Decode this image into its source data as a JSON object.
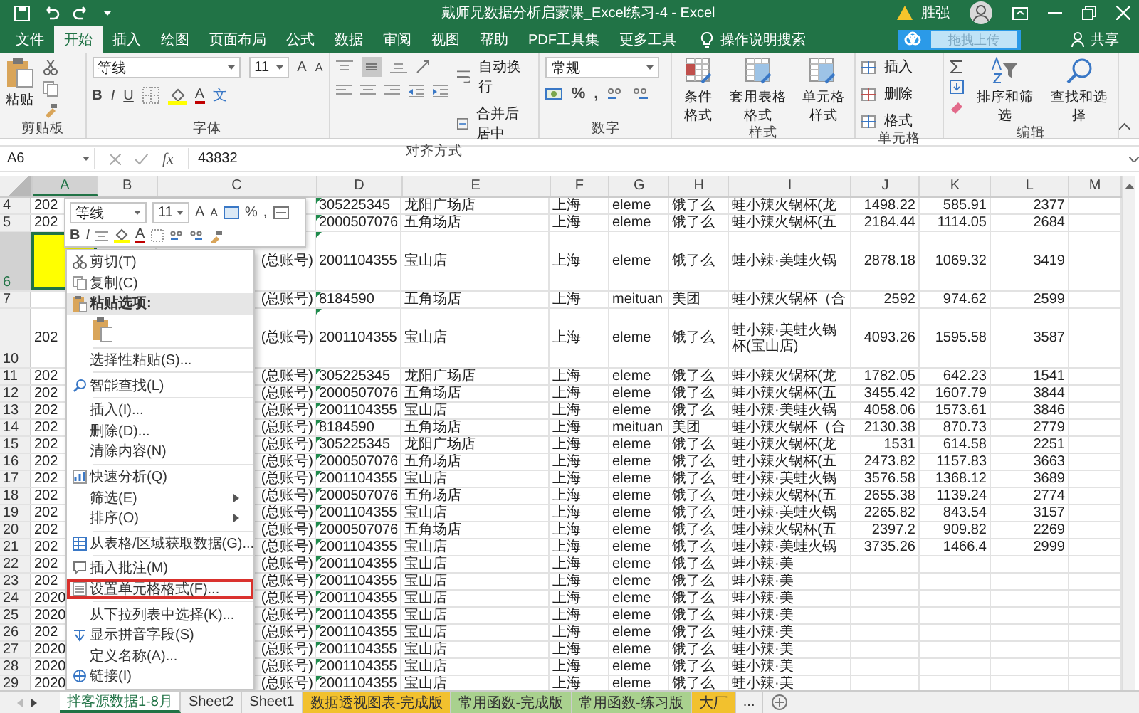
{
  "window": {
    "title": "戴师兄数据分析启蒙课_Excel练习-4  -  Excel",
    "user": "胜强"
  },
  "menu_tabs": [
    {
      "label": "文件",
      "selected": false
    },
    {
      "label": "开始",
      "selected": true
    },
    {
      "label": "插入",
      "selected": false
    },
    {
      "label": "绘图",
      "selected": false
    },
    {
      "label": "页面布局",
      "selected": false
    },
    {
      "label": "公式",
      "selected": false
    },
    {
      "label": "数据",
      "selected": false
    },
    {
      "label": "审阅",
      "selected": false
    },
    {
      "label": "视图",
      "selected": false
    },
    {
      "label": "帮助",
      "selected": false
    },
    {
      "label": "PDF工具集",
      "selected": false
    },
    {
      "label": "更多工具",
      "selected": false
    }
  ],
  "tell_me": "操作说明搜索",
  "upload_button": "拖拽上传",
  "share": "共享",
  "ribbon": {
    "clipboard": {
      "label": "剪贴板",
      "paste": "粘贴"
    },
    "font": {
      "label": "字体",
      "font_name": "等线",
      "font_size": "11",
      "grow": "A",
      "shrink": "A",
      "styles": [
        "B",
        "I",
        "U"
      ],
      "font_color": "A",
      "phonetic": "文"
    },
    "alignment": {
      "label": "对齐方式",
      "wrap": "自动换行",
      "merge": "合并后居中"
    },
    "number": {
      "label": "数字",
      "format": "常规",
      "symbols": [
        "%",
        ","
      ]
    },
    "styles": {
      "label": "样式",
      "buttons": [
        "条件格式",
        "套用表格格式",
        "单元格样式"
      ]
    },
    "cells": {
      "label": "单元格",
      "buttons": [
        "插入",
        "删除",
        "格式"
      ]
    },
    "editing": {
      "label": "编辑",
      "buttons": [
        "排序和筛选",
        "查找和选择"
      ]
    }
  },
  "formula_bar": {
    "name_box": "A6",
    "fx": "fx",
    "value": "43832"
  },
  "mini_toolbar": {
    "font_name": "等线",
    "font_size": "11",
    "grow": "A",
    "shrink": "A",
    "percent": "%",
    "comma": ",",
    "bold": "B",
    "italic": "I",
    "font_color": "A"
  },
  "columns": [
    {
      "label": "A",
      "selected": true
    },
    {
      "label": "B",
      "selected": false
    },
    {
      "label": "C",
      "selected": false
    },
    {
      "label": "D",
      "selected": false
    },
    {
      "label": "E",
      "selected": false
    },
    {
      "label": "F",
      "selected": false
    },
    {
      "label": "G",
      "selected": false
    },
    {
      "label": "H",
      "selected": false
    },
    {
      "label": "I",
      "selected": false
    },
    {
      "label": "J",
      "selected": false
    },
    {
      "label": "K",
      "selected": false
    },
    {
      "label": "L",
      "selected": false
    },
    {
      "label": "M",
      "selected": false
    }
  ],
  "rows": [
    {
      "number": "4",
      "selected": false,
      "tall": false,
      "cells": [
        "202",
        null,
        null,
        "305225345",
        "龙阳广场店",
        "上海",
        "eleme",
        "饿了么",
        "蛙小辣火锅杯(龙",
        "1498.22",
        "585.91",
        "2377"
      ]
    },
    {
      "number": "5",
      "selected": false,
      "tall": false,
      "cells": [
        "202",
        null,
        null,
        "2000507076",
        "五角场店",
        "上海",
        "eleme",
        "饿了么",
        "蛙小辣火锅杯(五",
        "2184.44",
        "1114.05",
        "2684"
      ]
    },
    {
      "number": "6",
      "selected": true,
      "tall": true,
      "cells": [
        null,
        null,
        "(总账号)",
        "2001104355",
        "宝山店",
        "上海",
        "eleme",
        "饿了么",
        "蛙小辣·美蛙火锅",
        "2878.18",
        "1069.32",
        "3419"
      ]
    },
    {
      "number": "7",
      "selected": false,
      "tall": false,
      "cells": [
        null,
        null,
        "(总账号)",
        "8184590",
        "五角场店",
        "上海",
        "meituan",
        "美团",
        "蛙小辣火锅杯（合",
        "2592",
        "974.62",
        "2599"
      ]
    },
    {
      "number": "10",
      "selected": false,
      "tall": true,
      "cells": [
        "202",
        null,
        "(总账号)",
        "2001104355",
        "宝山店",
        "上海",
        "eleme",
        "饿了么",
        "蛙小辣·美蛙火锅杯(宝山店)",
        "4093.26",
        "1595.58",
        "3587"
      ]
    },
    {
      "number": "11",
      "selected": false,
      "tall": false,
      "cells": [
        "202",
        null,
        "(总账号)",
        "305225345",
        "龙阳广场店",
        "上海",
        "eleme",
        "饿了么",
        "蛙小辣火锅杯(龙",
        "1782.05",
        "642.23",
        "1541"
      ]
    },
    {
      "number": "12",
      "selected": false,
      "tall": false,
      "cells": [
        "202",
        null,
        "(总账号)",
        "2000507076",
        "五角场店",
        "上海",
        "eleme",
        "饿了么",
        "蛙小辣火锅杯(五",
        "3455.42",
        "1607.79",
        "3844"
      ]
    },
    {
      "number": "13",
      "selected": false,
      "tall": false,
      "cells": [
        "202",
        null,
        "(总账号)",
        "2001104355",
        "宝山店",
        "上海",
        "eleme",
        "饿了么",
        "蛙小辣·美蛙火锅",
        "4058.06",
        "1573.61",
        "3846"
      ]
    },
    {
      "number": "14",
      "selected": false,
      "tall": false,
      "cells": [
        "202",
        null,
        "(总账号)",
        "8184590",
        "五角场店",
        "上海",
        "meituan",
        "美团",
        "蛙小辣火锅杯（合",
        "2130.38",
        "870.73",
        "2779"
      ]
    },
    {
      "number": "15",
      "selected": false,
      "tall": false,
      "cells": [
        "202",
        null,
        "(总账号)",
        "305225345",
        "龙阳广场店",
        "上海",
        "eleme",
        "饿了么",
        "蛙小辣火锅杯(龙",
        "1531",
        "614.58",
        "2251"
      ]
    },
    {
      "number": "16",
      "selected": false,
      "tall": false,
      "cells": [
        "202",
        null,
        "(总账号)",
        "2000507076",
        "五角场店",
        "上海",
        "eleme",
        "饿了么",
        "蛙小辣火锅杯(五",
        "2473.82",
        "1157.83",
        "3663"
      ]
    },
    {
      "number": "17",
      "selected": false,
      "tall": false,
      "cells": [
        "202",
        null,
        "(总账号)",
        "2001104355",
        "宝山店",
        "上海",
        "eleme",
        "饿了么",
        "蛙小辣·美蛙火锅",
        "3576.58",
        "1368.12",
        "3689"
      ]
    },
    {
      "number": "18",
      "selected": false,
      "tall": false,
      "cells": [
        "202",
        null,
        "(总账号)",
        "2000507076",
        "五角场店",
        "上海",
        "eleme",
        "饿了么",
        "蛙小辣火锅杯(五",
        "2655.38",
        "1139.24",
        "2774"
      ]
    },
    {
      "number": "19",
      "selected": false,
      "tall": false,
      "cells": [
        "202",
        null,
        "(总账号)",
        "2001104355",
        "宝山店",
        "上海",
        "eleme",
        "饿了么",
        "蛙小辣·美蛙火锅",
        "2265.82",
        "843.54",
        "3157"
      ]
    },
    {
      "number": "20",
      "selected": false,
      "tall": false,
      "cells": [
        "202",
        null,
        "(总账号)",
        "2000507076",
        "五角场店",
        "上海",
        "eleme",
        "饿了么",
        "蛙小辣火锅杯(五",
        "2397.2",
        "909.82",
        "2269"
      ]
    },
    {
      "number": "21",
      "selected": false,
      "tall": false,
      "cells": [
        "202",
        null,
        "(总账号)",
        "2001104355",
        "宝山店",
        "上海",
        "eleme",
        "饿了么",
        "蛙小辣·美蛙火锅",
        "3735.26",
        "1466.4",
        "2999"
      ]
    },
    {
      "number": "22",
      "selected": false,
      "tall": false,
      "cells": [
        "202",
        null,
        "(总账号)",
        "2001104355",
        "宝山店",
        "上海",
        "eleme",
        "饿了么",
        "蛙小辣·美",
        null,
        null,
        null
      ]
    },
    {
      "number": "23",
      "selected": false,
      "tall": false,
      "cells": [
        "202",
        null,
        "(总账号)",
        "2001104355",
        "宝山店",
        "上海",
        "eleme",
        "饿了么",
        "蛙小辣·美",
        null,
        null,
        null
      ]
    },
    {
      "number": "24",
      "selected": false,
      "tall": false,
      "cells": [
        "2020",
        null,
        "(总账号)",
        "2001104355",
        "宝山店",
        "上海",
        "eleme",
        "饿了么",
        "蛙小辣·美",
        null,
        null,
        null
      ]
    },
    {
      "number": "25",
      "selected": false,
      "tall": false,
      "cells": [
        "2020",
        null,
        "(总账号)",
        "2001104355",
        "宝山店",
        "上海",
        "eleme",
        "饿了么",
        "蛙小辣·美",
        null,
        null,
        null
      ]
    },
    {
      "number": "26",
      "selected": false,
      "tall": false,
      "cells": [
        "202",
        null,
        "(总账号)",
        "2001104355",
        "宝山店",
        "上海",
        "eleme",
        "饿了么",
        "蛙小辣·美",
        null,
        null,
        null
      ]
    },
    {
      "number": "27",
      "selected": false,
      "tall": false,
      "cells": [
        "2020",
        null,
        "(总账号)",
        "2001104355",
        "宝山店",
        "上海",
        "eleme",
        "饿了么",
        "蛙小辣·美",
        null,
        null,
        null
      ]
    },
    {
      "number": "28",
      "selected": false,
      "tall": false,
      "cells": [
        "2020",
        null,
        "(总账号)",
        "2001104355",
        "宝山店",
        "上海",
        "eleme",
        "饿了么",
        "蛙小辣·美",
        null,
        null,
        null
      ]
    },
    {
      "number": "29",
      "selected": false,
      "tall": false,
      "cells": [
        "2020",
        null,
        "(总账号)",
        "2001104355",
        "宝山店",
        "上海",
        "eleme",
        "饿了么",
        "蛙小辣·美",
        null,
        null,
        null
      ]
    }
  ],
  "context_menu": [
    {
      "kind": "command",
      "label": "剪切(T)",
      "highlighted": false
    },
    {
      "kind": "command",
      "label": "复制(C)",
      "highlighted": false
    },
    {
      "kind": "section",
      "label": "粘贴选项:",
      "highlighted": false
    },
    {
      "kind": "paste-option",
      "highlighted": false
    },
    {
      "kind": "command",
      "label": "选择性粘贴(S)...",
      "highlighted": false
    },
    {
      "kind": "command",
      "label": "智能查找(L)",
      "highlighted": false
    },
    {
      "kind": "command",
      "label": "插入(I)...",
      "highlighted": false
    },
    {
      "kind": "command",
      "label": "删除(D)...",
      "highlighted": false
    },
    {
      "kind": "command",
      "label": "清除内容(N)",
      "highlighted": false
    },
    {
      "kind": "command",
      "label": "快速分析(Q)",
      "highlighted": false
    },
    {
      "kind": "submenu",
      "label": "筛选(E)",
      "highlighted": false
    },
    {
      "kind": "submenu",
      "label": "排序(O)",
      "highlighted": false
    },
    {
      "kind": "command",
      "label": "从表格/区域获取数据(G)...",
      "highlighted": false
    },
    {
      "kind": "command",
      "label": "插入批注(M)",
      "highlighted": false
    },
    {
      "kind": "command",
      "label": "设置单元格格式(F)...",
      "highlighted": true
    },
    {
      "kind": "command",
      "label": "从下拉列表中选择(K)...",
      "highlighted": false
    },
    {
      "kind": "command",
      "label": "显示拼音字段(S)",
      "highlighted": false
    },
    {
      "kind": "command",
      "label": "定义名称(A)...",
      "highlighted": false
    },
    {
      "kind": "command",
      "label": "链接(I)",
      "highlighted": false
    }
  ],
  "sheet_tabs": [
    {
      "label": "拌客源数据1-8月",
      "selected": true
    },
    {
      "label": "Sheet2",
      "selected": false
    },
    {
      "label": "Sheet1",
      "selected": false
    },
    {
      "label": "数据透视图表-完成版",
      "selected": false,
      "color": "#f2c12e"
    },
    {
      "label": "常用函数-完成版",
      "selected": false,
      "color": "#a9d18e"
    },
    {
      "label": "常用函数-练习版",
      "selected": false,
      "color": "#a9d18e"
    },
    {
      "label": "大厂",
      "selected": false,
      "color": "#f2c12e"
    }
  ],
  "more_tabs": "..."
}
